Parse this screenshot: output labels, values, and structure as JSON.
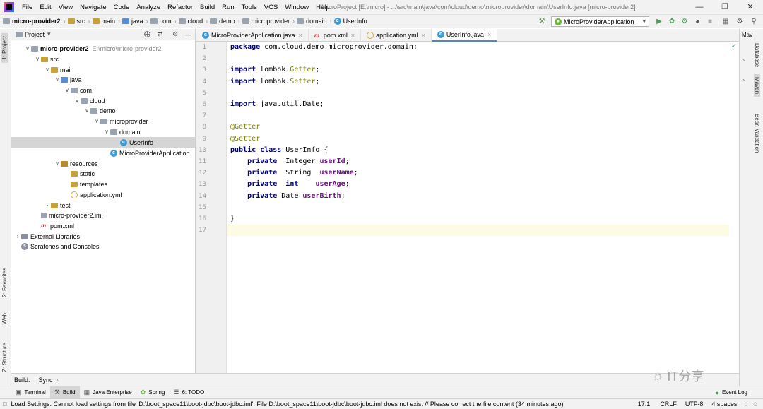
{
  "menu": [
    "File",
    "Edit",
    "View",
    "Navigate",
    "Code",
    "Analyze",
    "Refactor",
    "Build",
    "Run",
    "Tools",
    "VCS",
    "Window",
    "Help"
  ],
  "window_title": "MicroProject [E:\\micro] - ...\\src\\main\\java\\com\\cloud\\demo\\microprovider\\domain\\UserInfo.java [micro-provider2]",
  "breadcrumbs": [
    "micro-provider2",
    "src",
    "main",
    "java",
    "com",
    "cloud",
    "demo",
    "microprovider",
    "domain",
    "UserInfo"
  ],
  "run_config": "MicroProviderApplication",
  "project_panel": {
    "title": "Project",
    "tree": [
      {
        "label": "micro-provider2",
        "path": "E:\\micro\\micro-provider2",
        "icon": "module-folder-icon"
      },
      {
        "label": "src",
        "icon": "folder-icon"
      },
      {
        "label": "main",
        "icon": "folder-icon"
      },
      {
        "label": "java",
        "icon": "source-folder-icon"
      },
      {
        "label": "com",
        "icon": "package-icon"
      },
      {
        "label": "cloud",
        "icon": "package-icon"
      },
      {
        "label": "demo",
        "icon": "package-icon"
      },
      {
        "label": "microprovider",
        "icon": "package-icon"
      },
      {
        "label": "domain",
        "icon": "package-icon"
      },
      {
        "label": "UserInfo",
        "icon": "class-icon"
      },
      {
        "label": "MicroProviderApplication",
        "icon": "class-icon"
      },
      {
        "label": "resources",
        "icon": "resources-folder-icon"
      },
      {
        "label": "static",
        "icon": "folder-icon"
      },
      {
        "label": "templates",
        "icon": "folder-icon"
      },
      {
        "label": "application.yml",
        "icon": "yml-file-icon"
      },
      {
        "label": "test",
        "icon": "folder-icon"
      },
      {
        "label": "micro-provider2.iml",
        "icon": "iml-file-icon"
      },
      {
        "label": "pom.xml",
        "icon": "maven-file-icon"
      },
      {
        "label": "External Libraries",
        "icon": "libraries-icon"
      },
      {
        "label": "Scratches and Consoles",
        "icon": "scratches-icon"
      }
    ]
  },
  "editor_tabs": [
    {
      "label": "MicroProviderApplication.java",
      "icon": "class-icon"
    },
    {
      "label": "pom.xml",
      "icon": "maven-file-icon"
    },
    {
      "label": "application.yml",
      "icon": "yml-file-icon"
    },
    {
      "label": "UserInfo.java",
      "icon": "class-icon"
    }
  ],
  "code_lines": [
    "package com.cloud.demo.microprovider.domain;",
    "",
    "import lombok.Getter;",
    "import lombok.Setter;",
    "",
    "import java.util.Date;",
    "",
    "@Getter",
    "@Setter",
    "public class UserInfo {",
    "    private  Integer userId;",
    "    private  String  userName;",
    "    private  int    userAge;",
    "    private Date userBirth;",
    "",
    "}",
    ""
  ],
  "line_numbers": [
    "1",
    "2",
    "3",
    "4",
    "5",
    "6",
    "7",
    "8",
    "9",
    "10",
    "11",
    "12",
    "13",
    "14",
    "15",
    "16",
    "17"
  ],
  "left_strip": [
    "1: Project",
    "2: Favorites",
    "Web",
    "Z: Structure"
  ],
  "right_strip": [
    "Database",
    "Maven",
    "Bean Validation"
  ],
  "right_header": "Mav",
  "build_tabs": [
    "Build:",
    "Sync"
  ],
  "tool_windows": [
    {
      "label": "Terminal",
      "icon": "terminal-icon"
    },
    {
      "label": "Build",
      "icon": "build-icon"
    },
    {
      "label": "Java Enterprise",
      "icon": "java-enterprise-icon"
    },
    {
      "label": "Spring",
      "icon": "spring-icon"
    },
    {
      "label": "6: TODO",
      "icon": "todo-icon"
    }
  ],
  "event_log": "Event Log",
  "status": {
    "message": "Load Settings: Cannot load settings from file 'D:\\boot_space11\\boot-jdbc\\boot-jdbc.iml': File D:\\boot_space11\\boot-jdbc\\boot-jdbc.iml does not exist // Please correct the file content (34 minutes ago)",
    "position": "17:1",
    "line_sep": "CRLF",
    "encoding": "UTF-8",
    "indent": "4 spaces"
  },
  "watermark": "IT分享",
  "colors": {
    "keyword": "#000080",
    "annotation": "#808000",
    "field": "#660e7a",
    "selection": "#d5d5d5",
    "accent": "#4a88d6"
  }
}
